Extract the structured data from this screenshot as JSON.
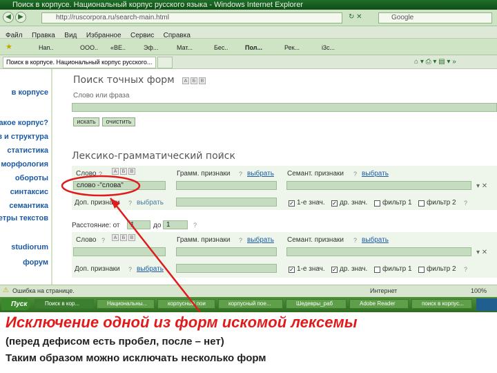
{
  "window": {
    "title": "Поиск в корпусе. Национальный корпус русского языка - Windows Internet Explorer",
    "address": "http://ruscorpora.ru/search-main.html",
    "search_provider": "Google"
  },
  "menu": [
    "Файл",
    "Правка",
    "Вид",
    "Избранное",
    "Сервис",
    "Справка"
  ],
  "favorites": [
    "Нап..",
    "OOO..",
    "«ВЕ..",
    "Эф...",
    "Мат...",
    "Бес..",
    "Пол...",
    "Рек...",
    "i3c..."
  ],
  "tab": {
    "label": "Поиск в корпусе. Национальный корпус русского..."
  },
  "sidebar": [
    "в корпусе",
    "такое корпус?",
    "в и структура",
    "статистика",
    "морфология",
    "обороты",
    "синтаксис",
    "семантика",
    "етры текстов",
    "studiorum",
    "форум"
  ],
  "exact": {
    "title": "Поиск точных форм",
    "field_label": "Слово или фраза",
    "search_btn": "искать",
    "clear_btn": "очистить"
  },
  "lexgram": {
    "title": "Лексико-грамматический поиск",
    "word_label": "Слово",
    "word_value": "слово -\"слова\"",
    "gram_label": "Грамм. признаки",
    "sem_label": "Семант. признаки",
    "choose": "выбрать",
    "add_label": "Доп. признаки",
    "opt1": "1-е знач.",
    "opt2": "др. знач.",
    "opt3": "фильтр 1",
    "opt4": "фильтр 2",
    "dist_label": "Расстояние: от",
    "dist_from": "1",
    "dist_to_label": "до",
    "dist_to": "1"
  },
  "status": {
    "left": "Ошибка на странице.",
    "zone": "Интернет",
    "zoom": "100%"
  },
  "taskbar": {
    "start": "Пуск",
    "items": [
      "Поиск в кор...",
      "Национальны...",
      "корпусный пои",
      "корпусный пое...",
      "Шедевры_раб",
      "Adobe Reader",
      "поиск в корпус..."
    ]
  },
  "caption": {
    "headline": "Исключение одной из форм искомой лексемы",
    "line1": "(перед дефисом есть пробел, после – нет)",
    "line2": "Таким образом можно исключать несколько форм"
  },
  "colors": {
    "annotation": "#e01b1b",
    "link": "#1b5aa6",
    "field": "#c5dcc0"
  }
}
